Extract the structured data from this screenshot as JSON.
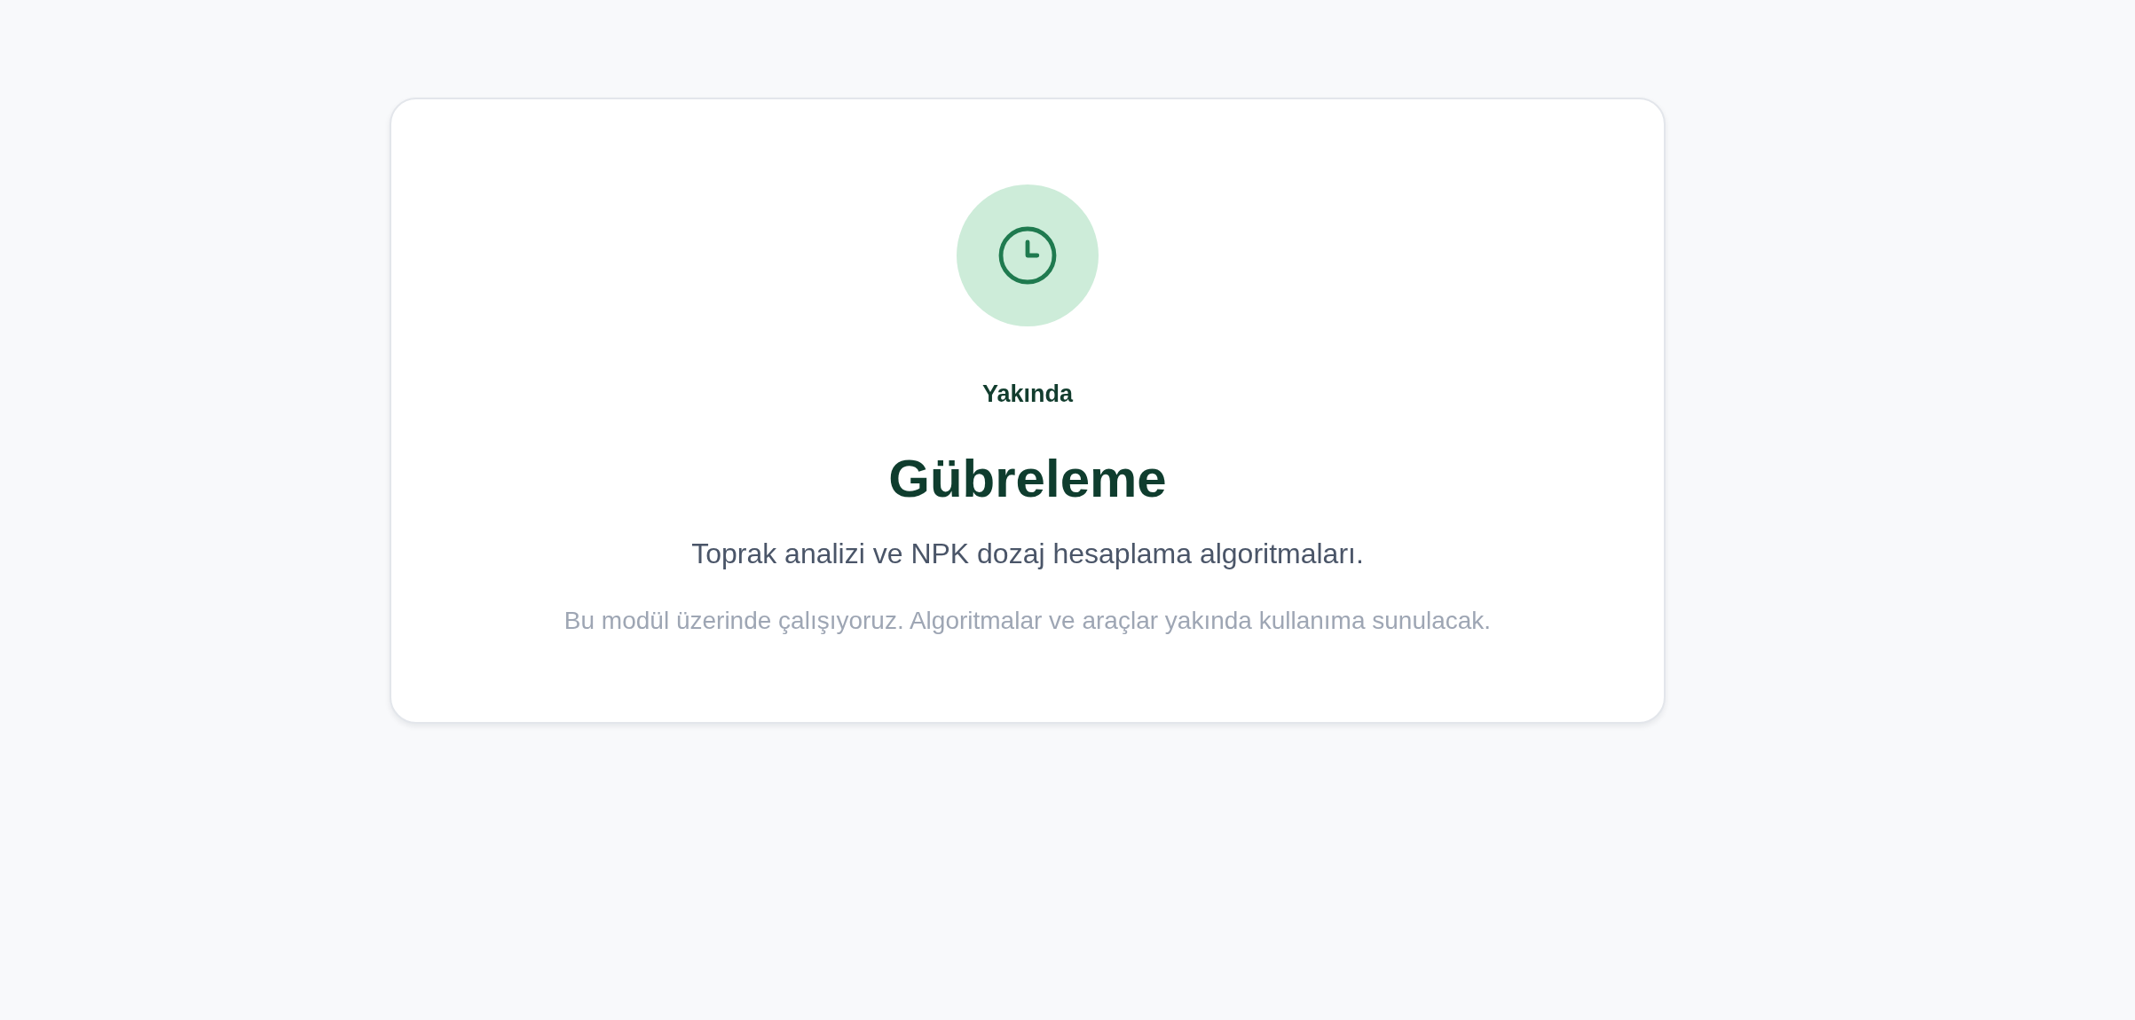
{
  "card": {
    "status_label": "Yakında",
    "title": "Gübreleme",
    "subtitle": "Toprak analizi ve NPK dozaj hesaplama algoritmaları.",
    "description": "Bu modül üzerinde çalışıyoruz. Algoritmalar ve araçlar yakında kullanıma sunulacak."
  }
}
